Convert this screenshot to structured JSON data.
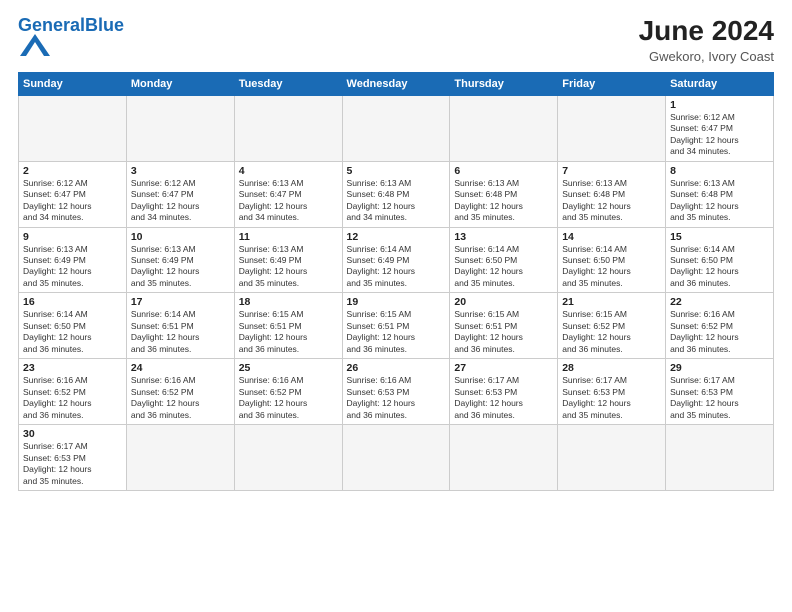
{
  "header": {
    "logo_general": "General",
    "logo_blue": "Blue",
    "month_title": "June 2024",
    "location": "Gwekoro, Ivory Coast"
  },
  "weekdays": [
    "Sunday",
    "Monday",
    "Tuesday",
    "Wednesday",
    "Thursday",
    "Friday",
    "Saturday"
  ],
  "weeks": [
    [
      {
        "day": "",
        "info": ""
      },
      {
        "day": "",
        "info": ""
      },
      {
        "day": "",
        "info": ""
      },
      {
        "day": "",
        "info": ""
      },
      {
        "day": "",
        "info": ""
      },
      {
        "day": "",
        "info": ""
      },
      {
        "day": "1",
        "info": "Sunrise: 6:12 AM\nSunset: 6:47 PM\nDaylight: 12 hours\nand 34 minutes."
      }
    ],
    [
      {
        "day": "2",
        "info": "Sunrise: 6:12 AM\nSunset: 6:47 PM\nDaylight: 12 hours\nand 34 minutes."
      },
      {
        "day": "3",
        "info": "Sunrise: 6:12 AM\nSunset: 6:47 PM\nDaylight: 12 hours\nand 34 minutes."
      },
      {
        "day": "4",
        "info": "Sunrise: 6:13 AM\nSunset: 6:47 PM\nDaylight: 12 hours\nand 34 minutes."
      },
      {
        "day": "5",
        "info": "Sunrise: 6:13 AM\nSunset: 6:48 PM\nDaylight: 12 hours\nand 34 minutes."
      },
      {
        "day": "6",
        "info": "Sunrise: 6:13 AM\nSunset: 6:48 PM\nDaylight: 12 hours\nand 35 minutes."
      },
      {
        "day": "7",
        "info": "Sunrise: 6:13 AM\nSunset: 6:48 PM\nDaylight: 12 hours\nand 35 minutes."
      },
      {
        "day": "8",
        "info": "Sunrise: 6:13 AM\nSunset: 6:48 PM\nDaylight: 12 hours\nand 35 minutes."
      }
    ],
    [
      {
        "day": "9",
        "info": "Sunrise: 6:13 AM\nSunset: 6:49 PM\nDaylight: 12 hours\nand 35 minutes."
      },
      {
        "day": "10",
        "info": "Sunrise: 6:13 AM\nSunset: 6:49 PM\nDaylight: 12 hours\nand 35 minutes."
      },
      {
        "day": "11",
        "info": "Sunrise: 6:13 AM\nSunset: 6:49 PM\nDaylight: 12 hours\nand 35 minutes."
      },
      {
        "day": "12",
        "info": "Sunrise: 6:14 AM\nSunset: 6:49 PM\nDaylight: 12 hours\nand 35 minutes."
      },
      {
        "day": "13",
        "info": "Sunrise: 6:14 AM\nSunset: 6:50 PM\nDaylight: 12 hours\nand 35 minutes."
      },
      {
        "day": "14",
        "info": "Sunrise: 6:14 AM\nSunset: 6:50 PM\nDaylight: 12 hours\nand 35 minutes."
      },
      {
        "day": "15",
        "info": "Sunrise: 6:14 AM\nSunset: 6:50 PM\nDaylight: 12 hours\nand 36 minutes."
      }
    ],
    [
      {
        "day": "16",
        "info": "Sunrise: 6:14 AM\nSunset: 6:50 PM\nDaylight: 12 hours\nand 36 minutes."
      },
      {
        "day": "17",
        "info": "Sunrise: 6:14 AM\nSunset: 6:51 PM\nDaylight: 12 hours\nand 36 minutes."
      },
      {
        "day": "18",
        "info": "Sunrise: 6:15 AM\nSunset: 6:51 PM\nDaylight: 12 hours\nand 36 minutes."
      },
      {
        "day": "19",
        "info": "Sunrise: 6:15 AM\nSunset: 6:51 PM\nDaylight: 12 hours\nand 36 minutes."
      },
      {
        "day": "20",
        "info": "Sunrise: 6:15 AM\nSunset: 6:51 PM\nDaylight: 12 hours\nand 36 minutes."
      },
      {
        "day": "21",
        "info": "Sunrise: 6:15 AM\nSunset: 6:52 PM\nDaylight: 12 hours\nand 36 minutes."
      },
      {
        "day": "22",
        "info": "Sunrise: 6:16 AM\nSunset: 6:52 PM\nDaylight: 12 hours\nand 36 minutes."
      }
    ],
    [
      {
        "day": "23",
        "info": "Sunrise: 6:16 AM\nSunset: 6:52 PM\nDaylight: 12 hours\nand 36 minutes."
      },
      {
        "day": "24",
        "info": "Sunrise: 6:16 AM\nSunset: 6:52 PM\nDaylight: 12 hours\nand 36 minutes."
      },
      {
        "day": "25",
        "info": "Sunrise: 6:16 AM\nSunset: 6:52 PM\nDaylight: 12 hours\nand 36 minutes."
      },
      {
        "day": "26",
        "info": "Sunrise: 6:16 AM\nSunset: 6:53 PM\nDaylight: 12 hours\nand 36 minutes."
      },
      {
        "day": "27",
        "info": "Sunrise: 6:17 AM\nSunset: 6:53 PM\nDaylight: 12 hours\nand 36 minutes."
      },
      {
        "day": "28",
        "info": "Sunrise: 6:17 AM\nSunset: 6:53 PM\nDaylight: 12 hours\nand 35 minutes."
      },
      {
        "day": "29",
        "info": "Sunrise: 6:17 AM\nSunset: 6:53 PM\nDaylight: 12 hours\nand 35 minutes."
      }
    ],
    [
      {
        "day": "30",
        "info": "Sunrise: 6:17 AM\nSunset: 6:53 PM\nDaylight: 12 hours\nand 35 minutes."
      },
      {
        "day": "",
        "info": ""
      },
      {
        "day": "",
        "info": ""
      },
      {
        "day": "",
        "info": ""
      },
      {
        "day": "",
        "info": ""
      },
      {
        "day": "",
        "info": ""
      },
      {
        "day": "",
        "info": ""
      }
    ]
  ]
}
